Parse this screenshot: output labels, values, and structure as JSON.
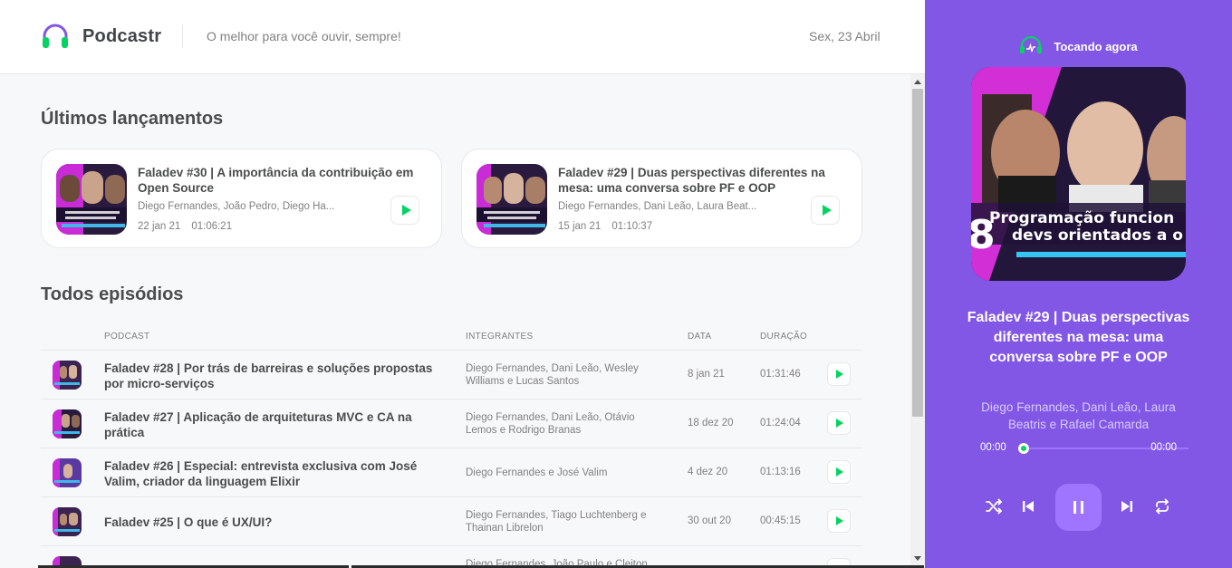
{
  "header": {
    "brand": "Podcastr",
    "tagline": "O melhor para você ouvir, sempre!",
    "date": "Sex, 23 Abril"
  },
  "latest": {
    "title": "Últimos lançamentos",
    "episodes": [
      {
        "title": "Faladev #30 | A importância da contribuição em Open Source",
        "members": "Diego Fernandes, João Pedro, Diego Ha...",
        "date": "22 jan 21",
        "duration": "01:06:21"
      },
      {
        "title": "Faladev #29 | Duas perspectivas diferentes na mesa: uma conversa sobre PF e OOP",
        "members": "Diego Fernandes, Dani Leão, Laura Beat...",
        "date": "15 jan 21",
        "duration": "01:10:37"
      }
    ]
  },
  "all": {
    "title": "Todos episódios",
    "columns": [
      "Podcast",
      "Integrantes",
      "Data",
      "Duração"
    ],
    "episodes": [
      {
        "title": "Faladev #28 | Por trás de barreiras e soluções propostas por micro-serviços",
        "members": "Diego Fernandes, Dani Leão, Wesley Williams e Lucas Santos",
        "date": "8 jan 21",
        "duration": "01:31:46"
      },
      {
        "title": "Faladev #27 | Aplicação de arquiteturas MVC e CA na prática",
        "members": "Diego Fernandes, Dani Leão, Otávio Lemos e Rodrigo Branas",
        "date": "18 dez 20",
        "duration": "01:24:04"
      },
      {
        "title": "Faladev #26 | Especial: entrevista exclusiva com José Valim, criador da linguagem Elixir",
        "members": "Diego Fernandes e José Valim",
        "date": "4 dez 20",
        "duration": "01:13:16"
      },
      {
        "title": "Faladev #25 | O que é UX/UI?",
        "members": "Diego Fernandes, Tiago Luchtenberg e Thainan Librelon",
        "date": "30 out 20",
        "duration": "00:45:15"
      },
      {
        "title": "",
        "members": "Diego Fernandes, João Paulo e Cleiton",
        "date": "",
        "duration": ""
      }
    ]
  },
  "player": {
    "now_playing": "Tocando agora",
    "title": "Faladev #29 | Duas perspectivas diferentes na mesa: uma conversa sobre PF e OOP",
    "members": "Diego Fernandes, Dani Leão, Laura Beatris e Rafael Camarda",
    "elapsed": "00:00",
    "total": "00:00",
    "progress_fraction": 0,
    "cover_text_line1": "Programação funcion",
    "cover_text_line2": "devs orientados a o",
    "cover_number": "8"
  },
  "icons": {
    "logo": "headphones-icon",
    "now_playing": "playing-icon",
    "shuffle": "shuffle-icon",
    "previous": "skip-previous-icon",
    "pause": "pause-icon",
    "next": "skip-next-icon",
    "repeat": "repeat-icon",
    "play": "play-icon"
  },
  "colors": {
    "accent": "#8257e5",
    "accent_light": "#9f75ff",
    "play_green": "#04d361",
    "brand_pink": "#e12ce1"
  }
}
